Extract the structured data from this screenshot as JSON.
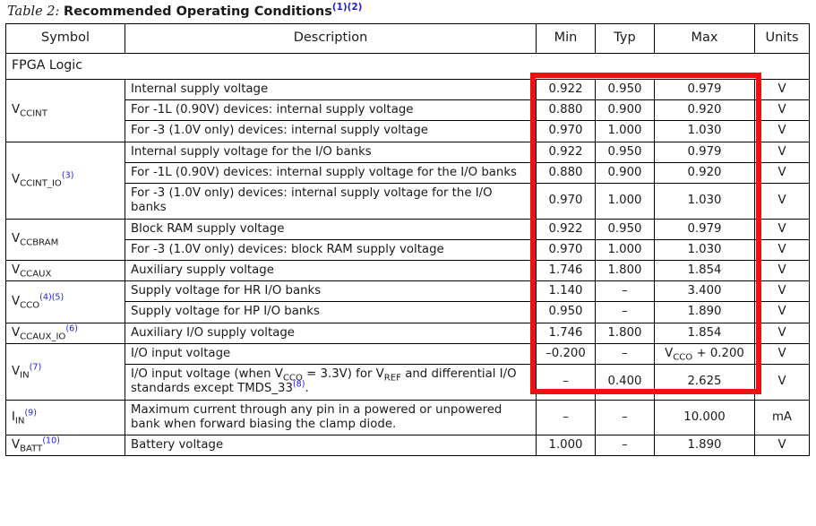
{
  "caption": {
    "label": "Table  2:",
    "title": "Recommended Operating Conditions",
    "footnotes": "(1)(2)"
  },
  "table": {
    "headers": {
      "symbol": "Symbol",
      "description": "Description",
      "min": "Min",
      "typ": "Typ",
      "max": "Max",
      "units": "Units"
    },
    "section_label": "FPGA Logic",
    "rows": [
      {
        "symbol_base": "V",
        "symbol_sub": "CCINT",
        "symbol_fn": "",
        "description": "Internal supply voltage",
        "min": "0.922",
        "typ": "0.950",
        "max": "0.979",
        "units": "V"
      },
      {
        "description": "For -1L (0.90V) devices: internal supply voltage",
        "min": "0.880",
        "typ": "0.900",
        "max": "0.920",
        "units": "V"
      },
      {
        "description": "For -3 (1.0V only) devices: internal supply voltage",
        "min": "0.970",
        "typ": "1.000",
        "max": "1.030",
        "units": "V"
      },
      {
        "symbol_base": "V",
        "symbol_sub": "CCINT_IO",
        "symbol_fn": "(3)",
        "description": "Internal supply voltage for the I/O banks",
        "min": "0.922",
        "typ": "0.950",
        "max": "0.979",
        "units": "V"
      },
      {
        "description": "For -1L (0.90V) devices: internal supply voltage for the I/O banks",
        "min": "0.880",
        "typ": "0.900",
        "max": "0.920",
        "units": "V"
      },
      {
        "description": "For -3 (1.0V only) devices: internal supply voltage for the I/O banks",
        "min": "0.970",
        "typ": "1.000",
        "max": "1.030",
        "units": "V"
      },
      {
        "symbol_base": "V",
        "symbol_sub": "CCBRAM",
        "symbol_fn": "",
        "description": "Block RAM supply voltage",
        "min": "0.922",
        "typ": "0.950",
        "max": "0.979",
        "units": "V"
      },
      {
        "description": "For -3 (1.0V only) devices: block RAM supply voltage",
        "min": "0.970",
        "typ": "1.000",
        "max": "1.030",
        "units": "V"
      },
      {
        "symbol_base": "V",
        "symbol_sub": "CCAUX",
        "symbol_fn": "",
        "description": "Auxiliary supply voltage",
        "min": "1.746",
        "typ": "1.800",
        "max": "1.854",
        "units": "V"
      },
      {
        "symbol_base": "V",
        "symbol_sub": "CCO",
        "symbol_fn": "(4)(5)",
        "description": "Supply voltage for HR I/O banks",
        "min": "1.140",
        "typ": "–",
        "max": "3.400",
        "units": "V"
      },
      {
        "description": "Supply voltage for HP I/O banks",
        "min": "0.950",
        "typ": "–",
        "max": "1.890",
        "units": "V"
      },
      {
        "symbol_base": "V",
        "symbol_sub": "CCAUX_IO",
        "symbol_fn": "(6)",
        "description": "Auxiliary I/O supply voltage",
        "min": "1.746",
        "typ": "1.800",
        "max": "1.854",
        "units": "V"
      },
      {
        "symbol_base": "V",
        "symbol_sub": "IN",
        "symbol_fn": "(7)",
        "description": "I/O input voltage",
        "min": "–0.200",
        "typ": "–",
        "max": "V_CCO + 0.200",
        "units": "V"
      },
      {
        "description": "I/O input voltage (when VCCO = 3.3V) for VREF and differential I/O standards except TMDS_33(8).",
        "min": "–",
        "typ": "0.400",
        "max": "2.625",
        "units": "V"
      },
      {
        "symbol_base": "I",
        "symbol_sub": "IN",
        "symbol_fn": "(9)",
        "description": "Maximum current through any pin in a powered or unpowered bank when forward biasing the clamp diode.",
        "min": "–",
        "typ": "–",
        "max": "10.000",
        "units": "mA"
      },
      {
        "symbol_base": "V",
        "symbol_sub": "BATT",
        "symbol_fn": "(10)",
        "description": "Battery voltage",
        "min": "1.000",
        "typ": "–",
        "max": "1.890",
        "units": "V"
      }
    ]
  },
  "annotation": {
    "highlight_color": "#ee1111",
    "header_rule_color": "#9c0034",
    "footnote_color": "#2323c8"
  }
}
